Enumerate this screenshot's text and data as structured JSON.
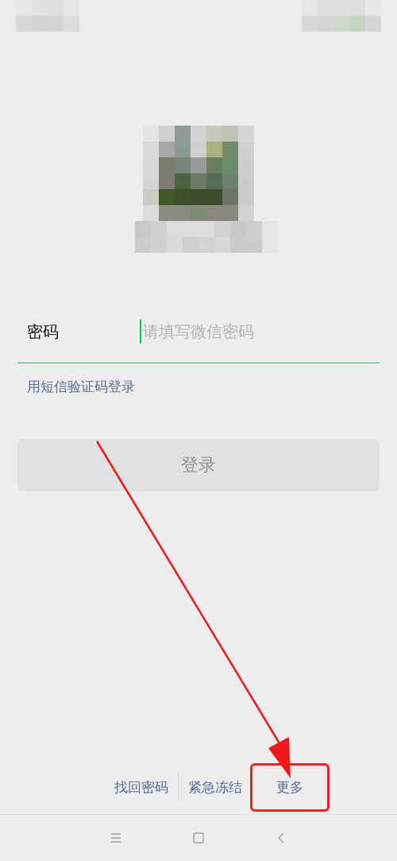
{
  "password_field": {
    "label": "密码",
    "placeholder": "请填写微信密码",
    "focused": true
  },
  "sms_login_link": "用短信验证码登录",
  "login_button": {
    "label": "登录",
    "disabled": true
  },
  "footer_links": [
    {
      "label": "找回密码",
      "highlighted": false
    },
    {
      "label": "紧急冻结",
      "highlighted": false
    },
    {
      "label": "更多",
      "highlighted": true
    }
  ],
  "annotations": [
    {
      "kind": "arrow"
    }
  ],
  "nav_bar": [
    {
      "kind": "menu"
    },
    {
      "kind": "home"
    },
    {
      "kind": "back"
    }
  ]
}
